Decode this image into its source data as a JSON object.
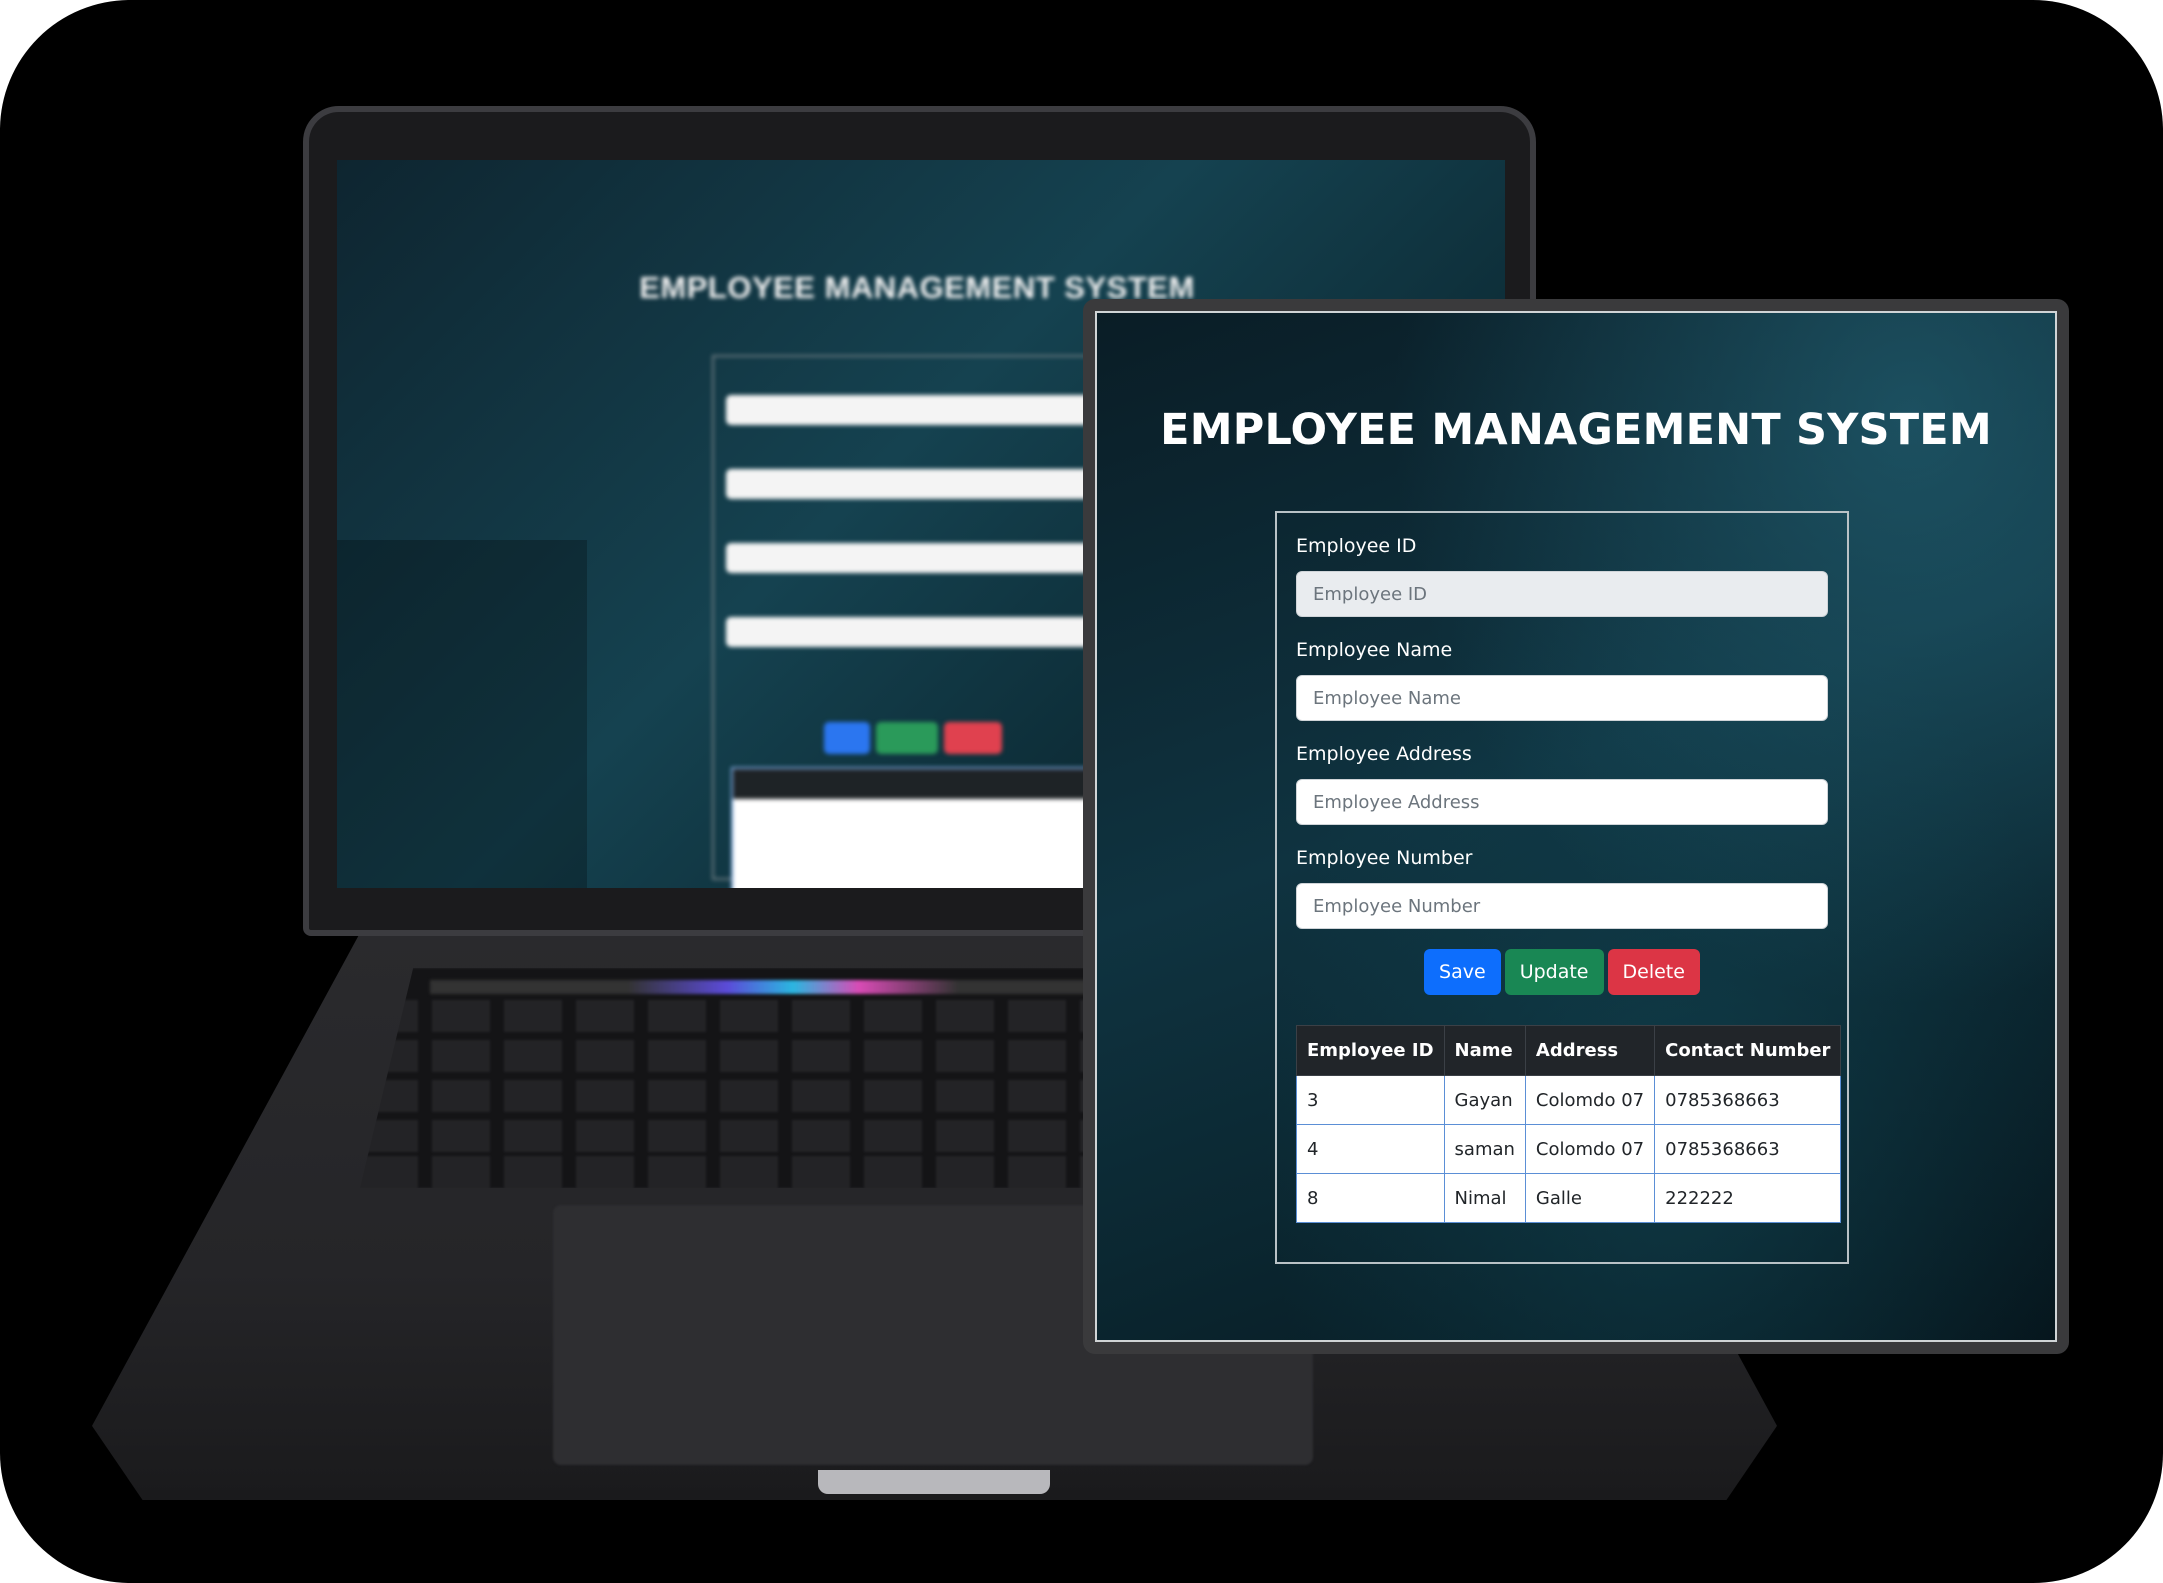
{
  "background_laptop": {
    "title": "EMPLOYEE MANAGEMENT SYSTEM"
  },
  "app": {
    "title": "EMPLOYEE MANAGEMENT SYSTEM",
    "form": {
      "employee_id": {
        "label": "Employee ID",
        "placeholder": "Employee ID",
        "value": ""
      },
      "employee_name": {
        "label": "Employee Name",
        "placeholder": "Employee Name",
        "value": ""
      },
      "employee_address": {
        "label": "Employee Address",
        "placeholder": "Employee Address",
        "value": ""
      },
      "employee_number": {
        "label": "Employee Number",
        "placeholder": "Employee Number",
        "value": ""
      }
    },
    "buttons": {
      "save": "Save",
      "update": "Update",
      "delete": "Delete"
    },
    "table": {
      "columns": [
        "Employee ID",
        "Name",
        "Address",
        "Contact Number"
      ],
      "rows": [
        [
          "3",
          "Gayan",
          "Colomdo 07",
          "0785368663"
        ],
        [
          "4",
          "saman",
          "Colomdo 07",
          "0785368663"
        ],
        [
          "8",
          "Nimal",
          "Galle",
          "222222"
        ]
      ]
    }
  },
  "colors": {
    "save": "#0d6efd",
    "update": "#198754",
    "delete": "#dc3545",
    "table_header": "#212529",
    "table_border": "#5b8fd6"
  }
}
